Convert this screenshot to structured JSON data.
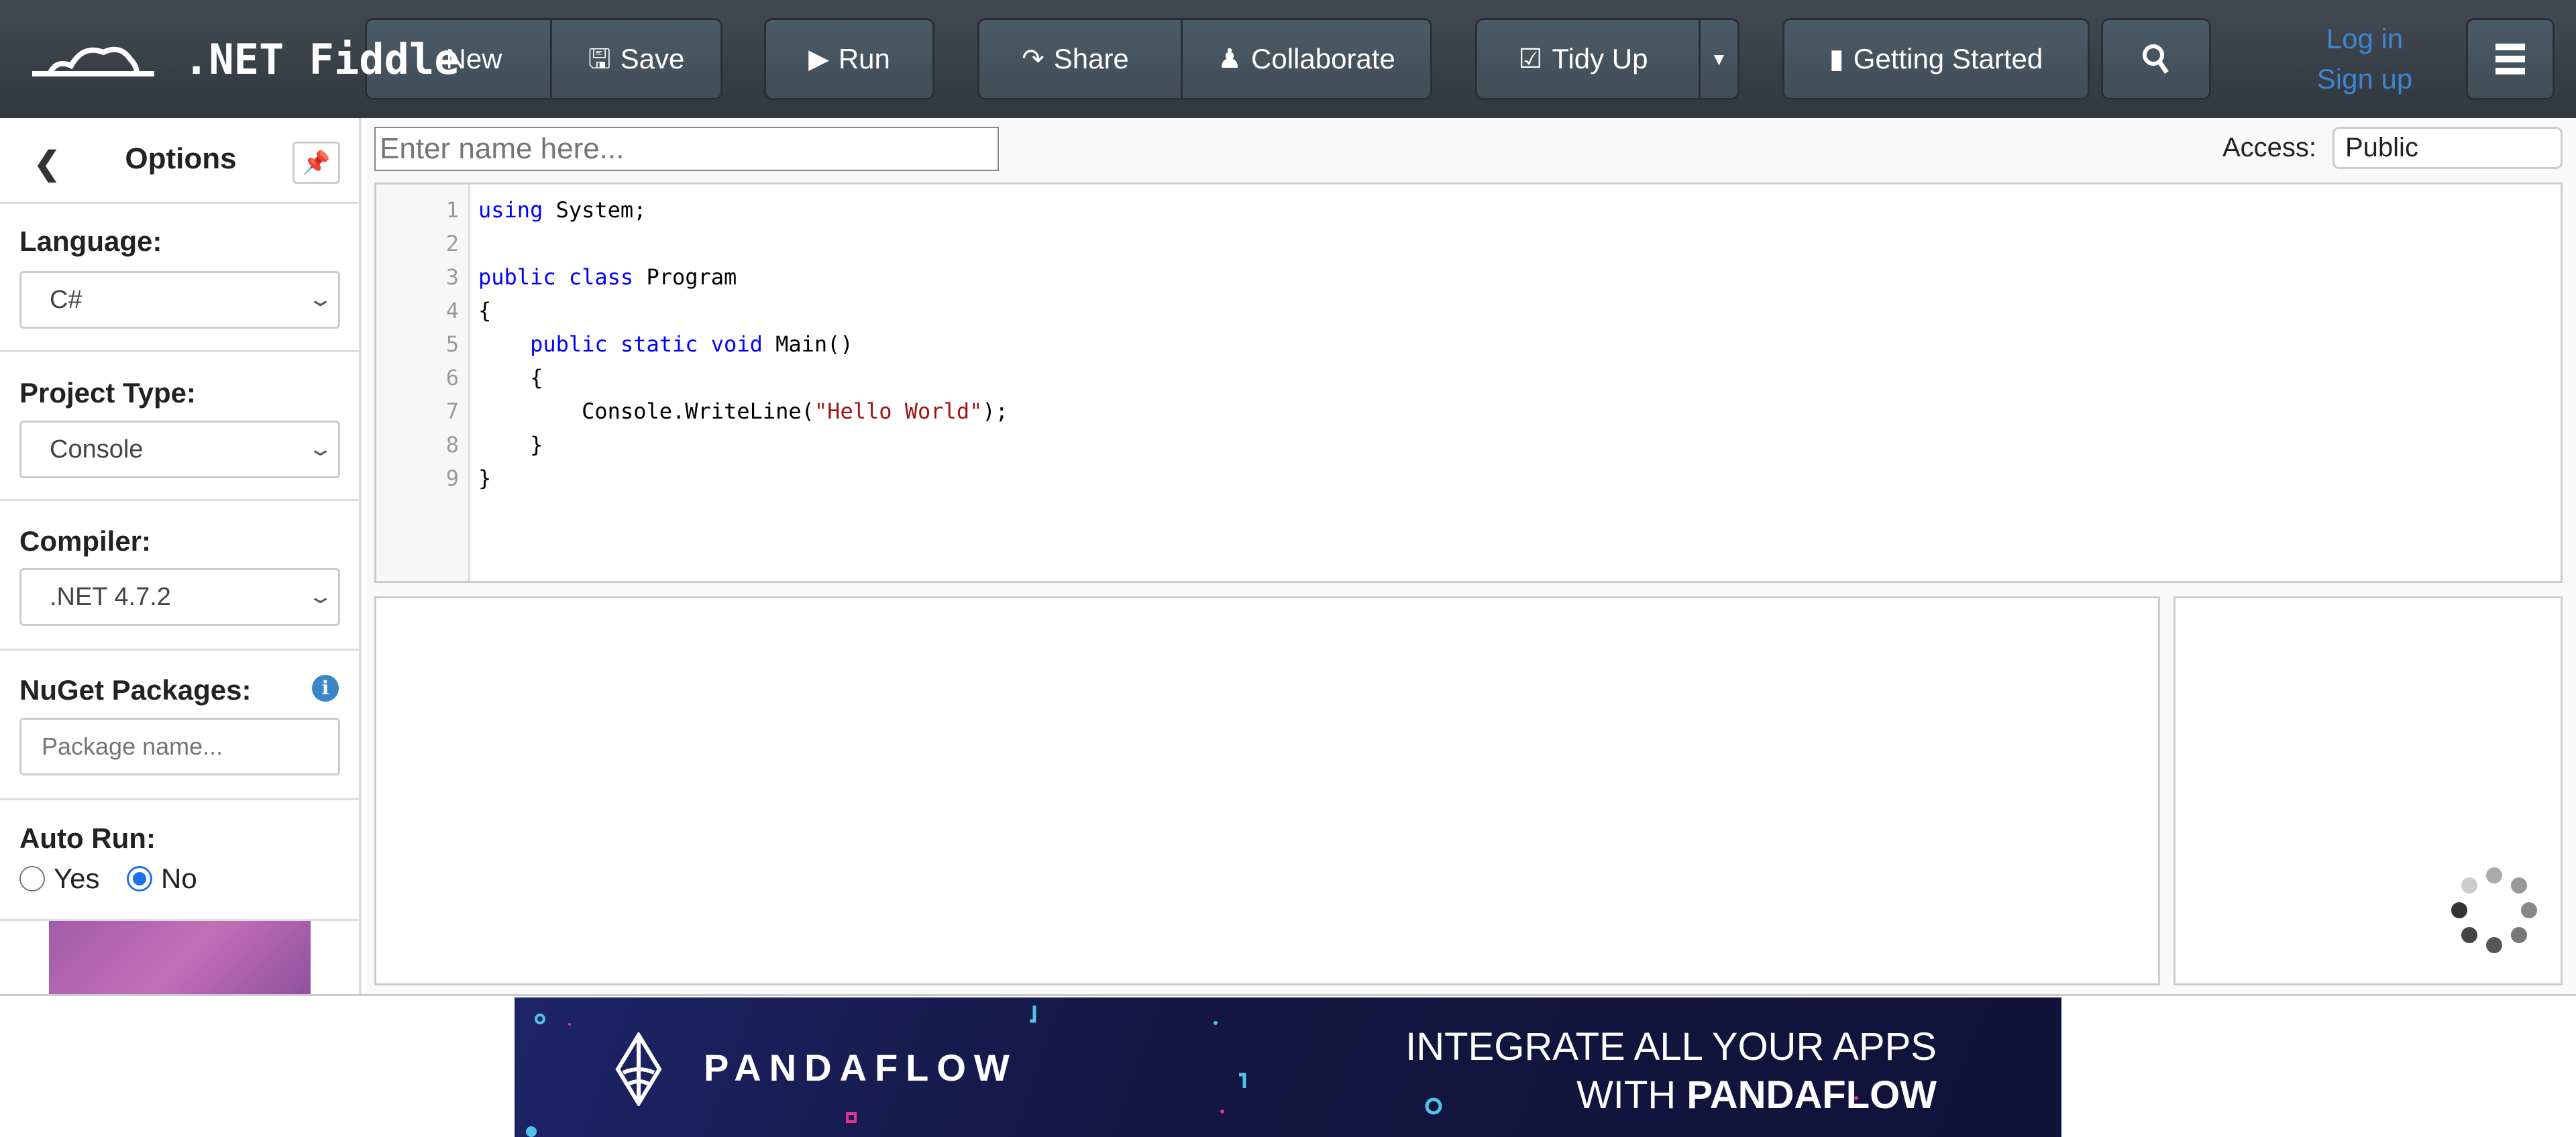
{
  "header": {
    "logo_text": ".NET Fiddle",
    "buttons": {
      "new": "New",
      "save": "Save",
      "run": "Run",
      "share": "Share",
      "collaborate": "Collaborate",
      "tidy_up": "Tidy Up",
      "getting_started": "Getting Started"
    },
    "log_in": "Log in",
    "sign_up": "Sign up"
  },
  "sidebar": {
    "title": "Options",
    "language_label": "Language:",
    "language_value": "C#",
    "project_type_label": "Project Type:",
    "project_type_value": "Console",
    "compiler_label": "Compiler:",
    "compiler_value": ".NET 4.7.2",
    "nuget_label": "NuGet Packages:",
    "nuget_placeholder": "Package name...",
    "auto_run_label": "Auto Run:",
    "auto_run_options": [
      "Yes",
      "No"
    ],
    "auto_run_selected": "No"
  },
  "main": {
    "name_placeholder": "Enter name here...",
    "access_label": "Access:",
    "access_value": "Public",
    "line_numbers": [
      "1",
      "2",
      "3",
      "4",
      "5",
      "6",
      "7",
      "8",
      "9"
    ]
  },
  "ad": {
    "brand": "PANDAFLOW",
    "headline_line1": "INTEGRATE ALL YOUR APPS",
    "headline_with": "WITH ",
    "headline_brand": "PANDAFLOW"
  },
  "colors": {
    "header_bg": "#3a4048",
    "link": "#3b86cf",
    "keyword": "#0000ff",
    "string": "#a31515",
    "radio_accent": "#1a73e8",
    "ad_bg": "#15173f"
  }
}
